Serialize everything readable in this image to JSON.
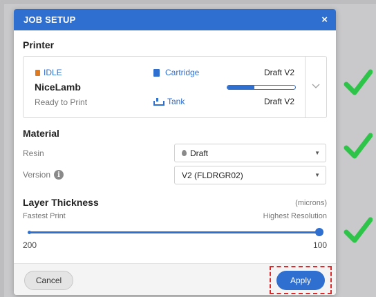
{
  "dialog": {
    "title": "JOB SETUP",
    "close_glyph": "×"
  },
  "printer": {
    "section_title": "Printer",
    "status": "IDLE",
    "name": "NiceLamb",
    "state": "Ready to Print",
    "cartridge_label": "Cartridge",
    "cartridge_value": "Draft V2",
    "cartridge_level": 0.4,
    "tank_label": "Tank",
    "tank_value": "Draft V2"
  },
  "material": {
    "section_title": "Material",
    "resin_label": "Resin",
    "resin_value": "Draft",
    "version_label": "Version",
    "version_value": "V2 (FLDRGR02)"
  },
  "layer_thickness": {
    "section_title": "Layer Thickness",
    "unit": "(microns)",
    "left_caption": "Fastest Print",
    "right_caption": "Highest Resolution",
    "min_label": "200",
    "max_label": "100",
    "value": "100"
  },
  "footer": {
    "cancel_label": "Cancel",
    "apply_label": "Apply"
  },
  "colors": {
    "accent": "#2f6fcf",
    "status_idle": "#e07a1f",
    "highlight": "#d92b2b",
    "check": "#2ec44a"
  },
  "icons": {
    "status": "status-dot-icon",
    "cartridge": "cartridge-icon",
    "tank": "tank-icon",
    "resin": "drop-icon",
    "version_info": "info-icon",
    "expand": "chevron-down-icon",
    "select_caret": "caret-down-icon",
    "annotation": "checkmark-icon"
  }
}
